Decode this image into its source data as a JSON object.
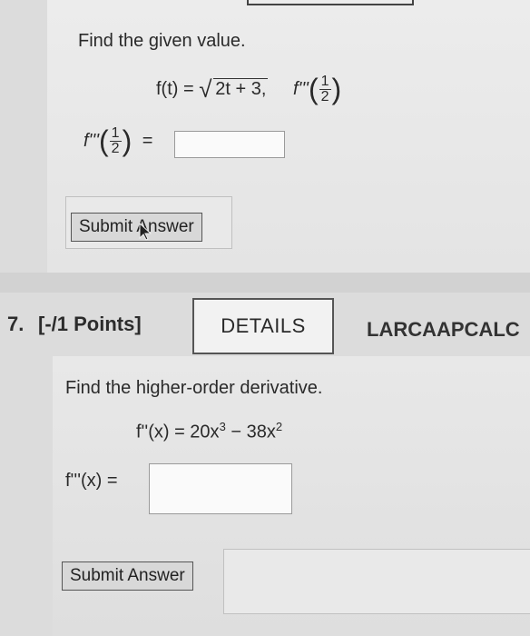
{
  "q6": {
    "prompt": "Find the given value.",
    "func_lhs": "f(t) = ",
    "func_radicand": "2t + 3,",
    "target_fn": "f'''",
    "frac_num": "1",
    "frac_den": "2",
    "answer_label_fn": "f'''",
    "equals": "=",
    "submit_label": "Submit Answer"
  },
  "q7": {
    "number": "7.",
    "points": "[-/1 Points]",
    "details_label": "DETAILS",
    "course_code": "LARCAAPCALC",
    "prompt": "Find the higher-order derivative.",
    "given": "f''(x) = 20x",
    "given_exp1": "3",
    "given_mid": " − 38x",
    "given_exp2": "2",
    "answer_label": "f'''(x) =",
    "submit_label": "Submit Answer"
  },
  "colors": {
    "background": "#dcdcdc",
    "panel": "#e8e8e8",
    "button": "#d8d8d8",
    "border": "#555555"
  }
}
